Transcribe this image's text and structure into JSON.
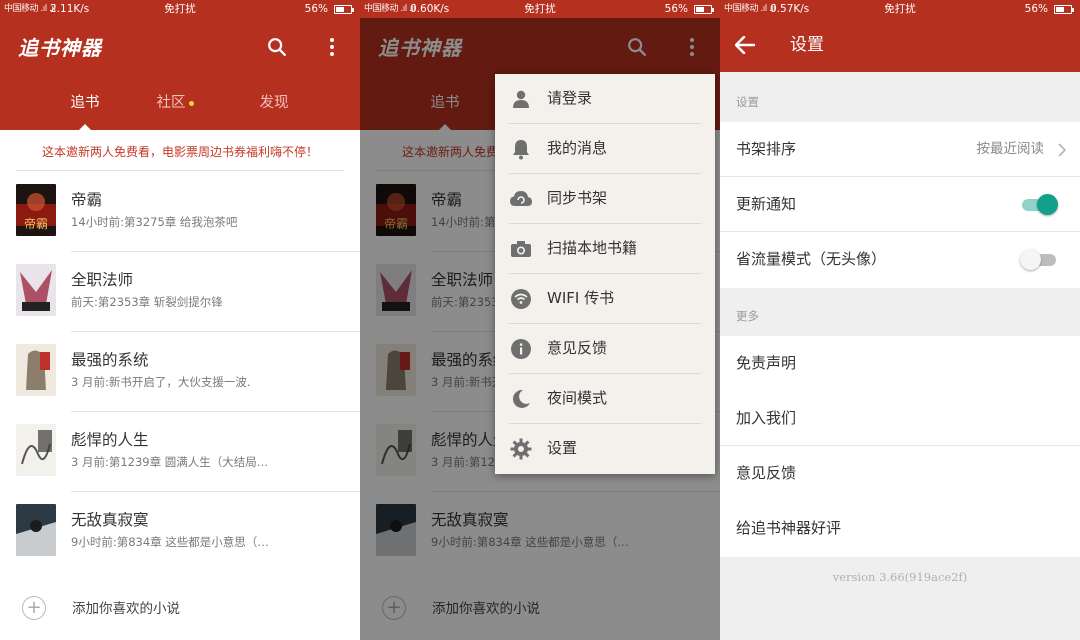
{
  "colors": {
    "brand": "#b5301f",
    "accent_toggle": "#12a08c",
    "banner_text": "#c43a27"
  },
  "status_bars": [
    {
      "signal": "中国移动 .ıl .ıl",
      "speed": "2.11K/s",
      "center": "免打扰",
      "right": "56%"
    },
    {
      "signal": "中国移动 .ıl .ıl",
      "speed": "0.60K/s",
      "center": "免打扰",
      "right": "56%"
    },
    {
      "signal": "中国移动 .ıl .ıl",
      "speed": "0.57K/s",
      "center": "免打扰",
      "right": "56%"
    }
  ],
  "battery_level": 0.56,
  "home": {
    "logo": "追书神器",
    "icons": {
      "search": "search-icon",
      "more": "more-vert-icon"
    },
    "tabs": [
      "追书",
      "社区",
      "发现"
    ],
    "active_tab": 0,
    "community_has_badge": true,
    "banner": "这本邀新两人免费看，电影票周边书券福利嗨不停！",
    "books": [
      {
        "title": "帝霸",
        "subtitle": "14小时前:第3275章 给我泡茶吧"
      },
      {
        "title": "全职法师",
        "subtitle": "前天:第2353章 斩裂剑提尔锋"
      },
      {
        "title": "最强的系统",
        "subtitle": "3 月前:新书开启了，大伙支援一波."
      },
      {
        "title": "彪悍的人生",
        "subtitle": "3 月前:第1239章 圆满人生（大结局…"
      },
      {
        "title": "无敌真寂寞",
        "subtitle": "9小时前:第834章 这些都是小意思（…"
      }
    ],
    "add_label": "添加你喜欢的小说"
  },
  "menu": {
    "items": [
      {
        "label": "请登录",
        "icon": "person-icon"
      },
      {
        "label": "我的消息",
        "icon": "bell-icon"
      },
      {
        "label": "同步书架",
        "icon": "cloud-sync-icon"
      },
      {
        "label": "扫描本地书籍",
        "icon": "camera-icon"
      },
      {
        "label": "WIFI 传书",
        "icon": "wifi-icon"
      },
      {
        "label": "意见反馈",
        "icon": "info-icon"
      },
      {
        "label": "夜间模式",
        "icon": "moon-icon"
      },
      {
        "label": "设置",
        "icon": "gear-icon"
      }
    ]
  },
  "settings": {
    "title": "设置",
    "back_icon": "arrow-back-icon",
    "section1": "设置",
    "shelf_sort_label": "书架排序",
    "shelf_sort_value": "按最近阅读",
    "update_notify_label": "更新通知",
    "update_notify_on": true,
    "data_saver_label": "省流量模式（无头像）",
    "data_saver_on": false,
    "section2": "更多",
    "more_items": [
      "免责声明",
      "加入我们",
      "意见反馈",
      "给追书神器好评"
    ],
    "version": "version 3.66(919ace2f)"
  }
}
